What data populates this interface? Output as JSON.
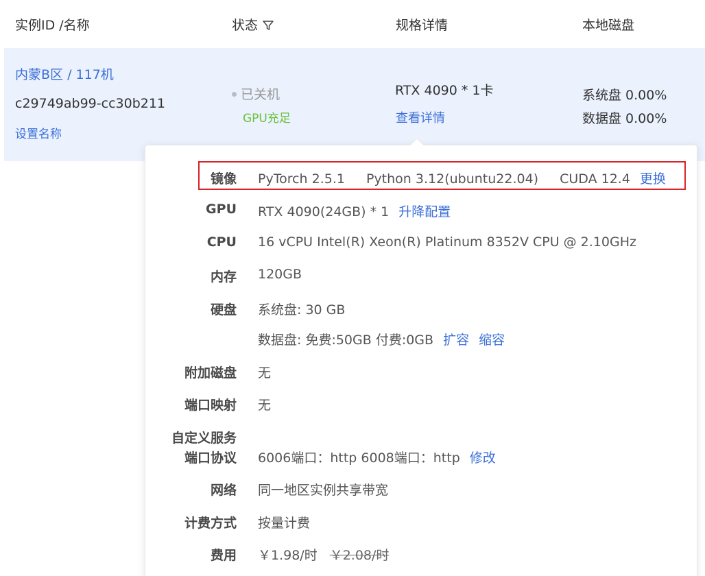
{
  "header": {
    "col_id": "实例ID /名称",
    "col_status": "状态",
    "col_spec": "规格详情",
    "col_disk": "本地磁盘"
  },
  "instance": {
    "region_machine": "内蒙B区 / 117机",
    "id": "c29749ab99-cc30b211",
    "set_name": "设置名称",
    "status": "已关机",
    "gpu_status": "GPU充足",
    "spec": "RTX 4090 * 1卡",
    "view_details": "查看详情",
    "system_disk": "系统盘 0.00%",
    "data_disk": "数据盘 0.00%"
  },
  "details": {
    "image_label": "镜像",
    "image_pytorch": "PyTorch  2.5.1",
    "image_python": "Python  3.12(ubuntu22.04)",
    "image_cuda": "CUDA  12.4",
    "image_change": "更换",
    "gpu_label": "GPU",
    "gpu_value": "RTX 4090(24GB) * 1",
    "gpu_upgrade": "升降配置",
    "cpu_label": "CPU",
    "cpu_value": "16 vCPU Intel(R) Xeon(R) Platinum 8352V CPU @ 2.10GHz",
    "mem_label": "内存",
    "mem_value": "120GB",
    "disk_label": "硬盘",
    "disk_system": "系统盘:  30 GB",
    "disk_data": "数据盘:  免费:50GB   付费:0GB",
    "disk_expand": "扩容",
    "disk_shrink": "缩容",
    "extra_disk_label": "附加磁盘",
    "extra_disk_value": "无",
    "port_map_label": "端口映射",
    "port_map_value": "无",
    "custom_service_label_1": "自定义服务",
    "custom_service_label_2": "端口协议",
    "custom_service_value": "6006端口：http     6008端口：http",
    "custom_service_edit": "修改",
    "network_label": "网络",
    "network_value": "同一地区实例共享带宽",
    "billing_label": "计费方式",
    "billing_value": "按量计费",
    "fee_label": "费用",
    "fee_value": "￥1.98/时",
    "fee_original": "￥2.08/时"
  },
  "colors": {
    "link": "#3a6fd8",
    "gpu_ok": "#67c23a",
    "row_bg": "#ebf1fd",
    "highlight_border": "#d9232b"
  }
}
